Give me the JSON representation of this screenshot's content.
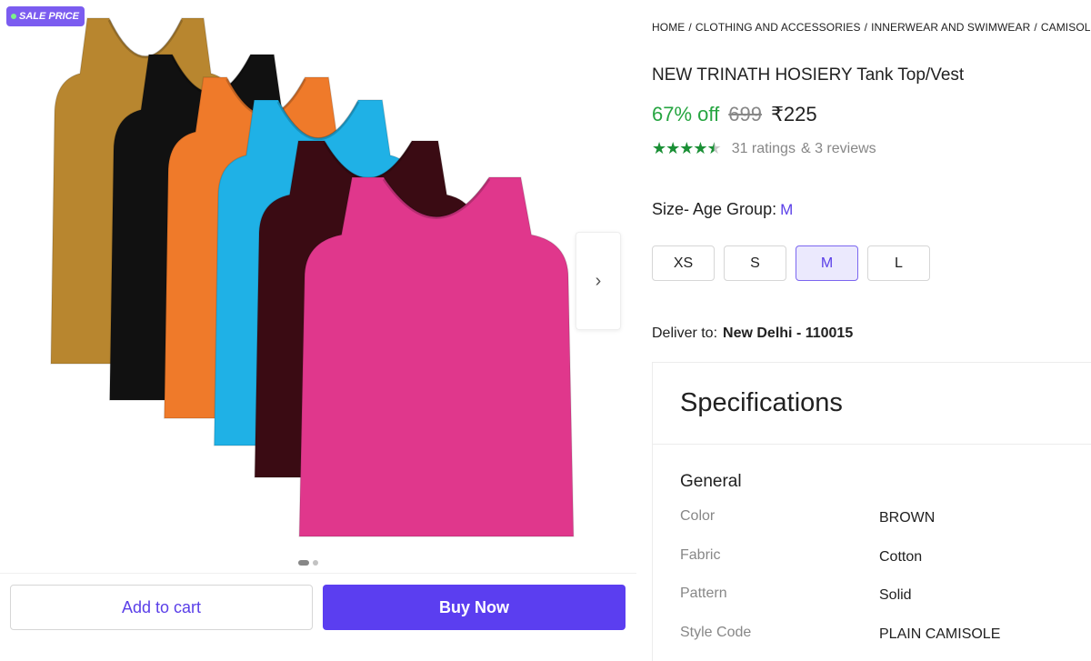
{
  "gallery": {
    "badge": "SALE PRICE",
    "image_alt": "Tank top vests in multiple colors",
    "vest_colors": [
      "#b8862f",
      "#111111",
      "#ef7a2a",
      "#1fb1e6",
      "#3a0b13",
      "#e0378c"
    ],
    "next_icon": "chevron-right-icon",
    "dots_total": 2,
    "dots_active_index": 0
  },
  "actions": {
    "add_to_cart": "Add to cart",
    "buy_now": "Buy Now"
  },
  "breadcrumb": [
    "HOME",
    "CLOTHING AND ACCESSORIES",
    "INNERWEAR AND SWIMWEAR",
    "CAMISOLE"
  ],
  "product": {
    "title": "NEW TRINATH HOSIERY Tank Top/Vest",
    "discount": "67% off",
    "mrp": "699",
    "price": "₹225",
    "rating_value": 4.5,
    "ratings_text": "31 ratings",
    "reviews_text": "& 3 reviews"
  },
  "size": {
    "label": "Size- Age Group:",
    "selected": "M",
    "options": [
      "XS",
      "S",
      "M",
      "L"
    ]
  },
  "delivery": {
    "label": "Deliver to:",
    "location": "New Delhi - 110015"
  },
  "specifications": {
    "title": "Specifications",
    "section": "General",
    "rows": [
      {
        "key": "Color",
        "value": "BROWN"
      },
      {
        "key": "Fabric",
        "value": "Cotton"
      },
      {
        "key": "Pattern",
        "value": "Solid"
      },
      {
        "key": "Style Code",
        "value": "PLAIN CAMISOLE"
      }
    ]
  },
  "colors": {
    "accent": "#5b3ef0",
    "discount_green": "#26a541",
    "star_green": "#1a8f35",
    "badge": "#7b5cf0"
  }
}
